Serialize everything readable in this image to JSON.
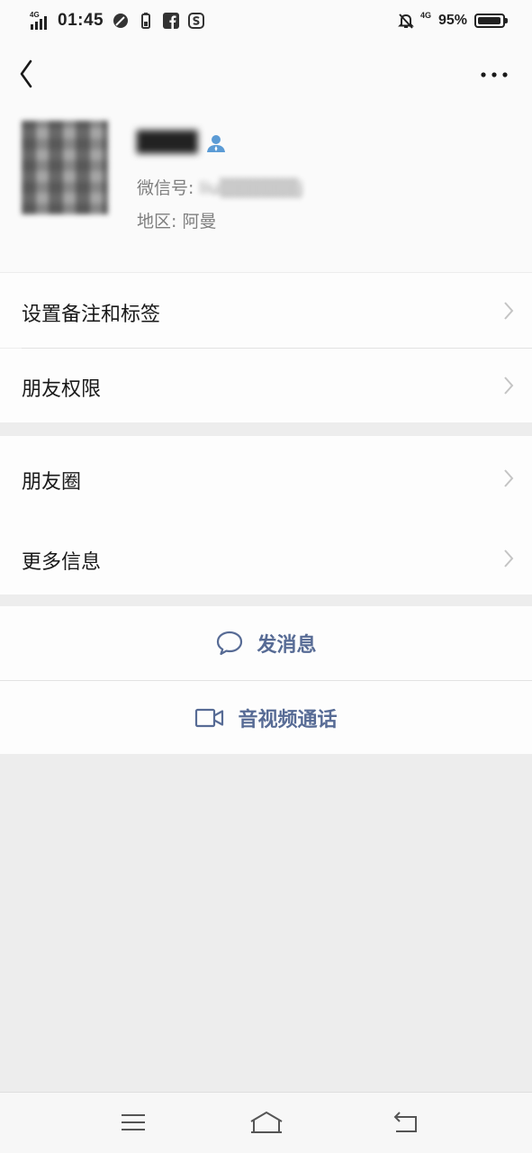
{
  "status_bar": {
    "network_left": "4G",
    "time": "01:45",
    "network_right": "4G",
    "battery_percent": "95%",
    "battery_level": 0.95,
    "icons": [
      "signal-icon",
      "leaf-icon",
      "battery-small-icon",
      "facebook-icon",
      "s-app-icon",
      "bell-off-icon",
      "battery-icon"
    ]
  },
  "nav": {
    "back_icon": "back-chevron-icon",
    "more_icon": "more-dots-icon"
  },
  "profile": {
    "nickname": "████",
    "wechat_id_label": "微信号:",
    "wechat_id_value": "liu▒▒▒▒▒▒j",
    "region_label": "地区:",
    "region_value": "阿曼"
  },
  "menu": {
    "remark_tags": "设置备注和标签",
    "friend_permissions": "朋友权限",
    "moments": "朋友圈",
    "more_info": "更多信息"
  },
  "actions": {
    "send_message": "发消息",
    "video_call": "音视频通话"
  },
  "colors": {
    "accent": "#576b95",
    "background": "#ededed",
    "card": "#fdfdfd",
    "verified_blue": "#5b9bd5"
  }
}
